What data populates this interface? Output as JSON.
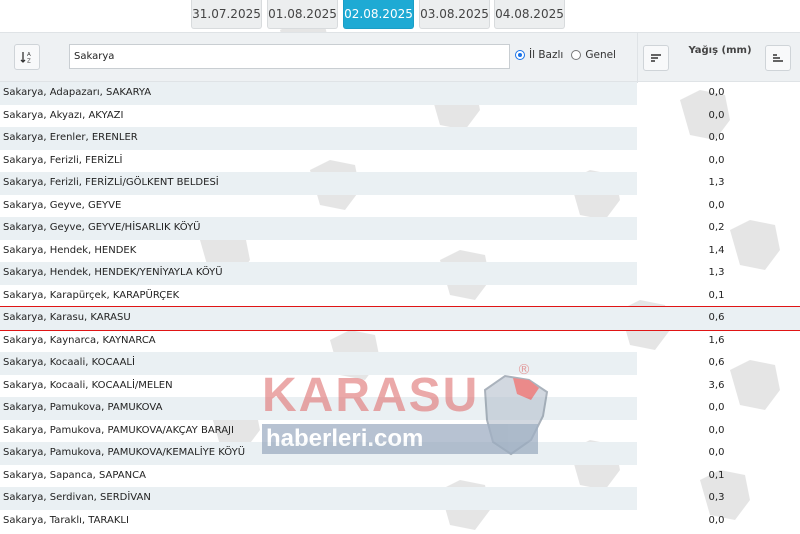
{
  "dates": [
    {
      "label": "31.07.2025",
      "active": false
    },
    {
      "label": "01.08.2025",
      "active": false
    },
    {
      "label": "02.08.2025",
      "active": true
    },
    {
      "label": "03.08.2025",
      "active": false
    },
    {
      "label": "04.08.2025",
      "active": false
    }
  ],
  "search": {
    "value": "Sakarya"
  },
  "radios": [
    {
      "label": "İl Bazlı",
      "checked": true
    },
    {
      "label": "Genel",
      "checked": false
    }
  ],
  "column_title": "Yağış (mm)",
  "rows": [
    {
      "name": "Sakarya, Adapazarı, SAKARYA",
      "value": "0,0"
    },
    {
      "name": "Sakarya, Akyazı, AKYAZI",
      "value": "0,0"
    },
    {
      "name": "Sakarya, Erenler, ERENLER",
      "value": "0,0"
    },
    {
      "name": "Sakarya, Ferizli, FERİZLİ",
      "value": "0,0"
    },
    {
      "name": "Sakarya, Ferizli, FERİZLİ/GÖLKENT BELDESİ",
      "value": "1,3"
    },
    {
      "name": "Sakarya, Geyve, GEYVE",
      "value": "0,0"
    },
    {
      "name": "Sakarya, Geyve, GEYVE/HİSARLIK KÖYÜ",
      "value": "0,2"
    },
    {
      "name": "Sakarya, Hendek, HENDEK",
      "value": "1,4"
    },
    {
      "name": "Sakarya, Hendek, HENDEK/YENİYAYLA KÖYÜ",
      "value": "1,3"
    },
    {
      "name": "Sakarya, Karapürçek, KARAPÜRÇEK",
      "value": "0,1"
    },
    {
      "name": "Sakarya, Karasu, KARASU",
      "value": "0,6",
      "highlight": true
    },
    {
      "name": "Sakarya, Kaynarca, KAYNARCA",
      "value": "1,6"
    },
    {
      "name": "Sakarya, Kocaali, KOCAALİ",
      "value": "0,6"
    },
    {
      "name": "Sakarya, Kocaali, KOCAALİ/MELEN",
      "value": "3,6"
    },
    {
      "name": "Sakarya, Pamukova, PAMUKOVA",
      "value": "0,0"
    },
    {
      "name": "Sakarya, Pamukova, PAMUKOVA/AKÇAY BARAJI",
      "value": "0,0"
    },
    {
      "name": "Sakarya, Pamukova, PAMUKOVA/KEMALİYE KÖYÜ",
      "value": "0,0"
    },
    {
      "name": "Sakarya, Sapanca, SAPANCA",
      "value": "0,1"
    },
    {
      "name": "Sakarya, Serdivan, SERDİVAN",
      "value": "0,3"
    },
    {
      "name": "Sakarya, Taraklı, TARAKLI",
      "value": "0,0"
    }
  ],
  "watermark": {
    "brand": "KARASU",
    "sub": "haberleri.com",
    "reg": "®"
  },
  "colors": {
    "active_tab": "#1eaad4",
    "highlight": "#e01515",
    "stripe": "#eaf0f3"
  }
}
